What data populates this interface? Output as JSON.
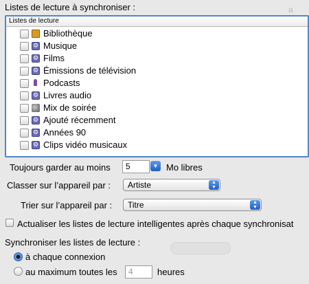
{
  "sync_label": "Listes de lecture à synchroniser :",
  "playlist_column_header": "Listes de lecture",
  "playlists": [
    {
      "label": "Bibliothèque",
      "icon": "library-icon"
    },
    {
      "label": "Musique",
      "icon": "smart-playlist-icon"
    },
    {
      "label": "Films",
      "icon": "smart-playlist-icon"
    },
    {
      "label": "Émissions de télévision",
      "icon": "smart-playlist-icon"
    },
    {
      "label": "Podcasts",
      "icon": "podcast-icon"
    },
    {
      "label": "Livres audio",
      "icon": "smart-playlist-icon"
    },
    {
      "label": "Mix de soirée",
      "icon": "party-shuffle-icon"
    },
    {
      "label": "Ajouté récemment",
      "icon": "smart-playlist-icon"
    },
    {
      "label": "Années 90",
      "icon": "smart-playlist-icon"
    },
    {
      "label": "Clips vidéo musicaux",
      "icon": "smart-playlist-icon"
    }
  ],
  "keep_free": {
    "label_before": "Toujours garder au moins",
    "value": "5",
    "label_after": "Mo libres"
  },
  "sort_by": {
    "label": "Classer sur l’appareil par :",
    "value": "Artiste"
  },
  "order_by": {
    "label": "Trier sur l’appareil par :",
    "value": "Titre"
  },
  "update_smart": {
    "label": "Actualiser les listes de lecture intelligentes après chaque synchronisat"
  },
  "sync_playlists_label": "Synchroniser les listes de lecture :",
  "options": {
    "each_connection": "à chaque connexion",
    "at_most_before": "au maximum toutes les",
    "hours_value": "4",
    "hours_unit": "heures"
  },
  "colors": {
    "accent": "#2d6cd1",
    "focus_ring": "#4f86c9",
    "background": "#e8e8e8"
  }
}
